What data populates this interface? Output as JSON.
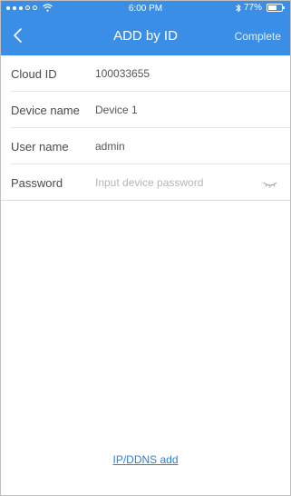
{
  "status_bar": {
    "time": "6:00 PM",
    "battery": "77%",
    "battery_level": 0.77,
    "signal_bars_filled": 3,
    "signal_bars_total": 5
  },
  "nav": {
    "title": "ADD by ID",
    "complete_label": "Complete"
  },
  "form": {
    "cloud_id": {
      "label": "Cloud ID",
      "value": "100033655"
    },
    "device_name": {
      "label": "Device name",
      "value": "Device 1"
    },
    "user_name": {
      "label": "User name",
      "value": "admin"
    },
    "password": {
      "label": "Password",
      "placeholder": "Input device password",
      "value": ""
    }
  },
  "footer": {
    "ip_ddns_link": "IP/DDNS add"
  },
  "colors": {
    "accent": "#3a8ee6",
    "link": "#2f7fd8"
  },
  "icons": {
    "back": "chevron-left-icon",
    "eye": "eye-closed-icon",
    "bluetooth": "bluetooth-icon",
    "wifi": "wifi-icon",
    "battery": "battery-icon"
  }
}
